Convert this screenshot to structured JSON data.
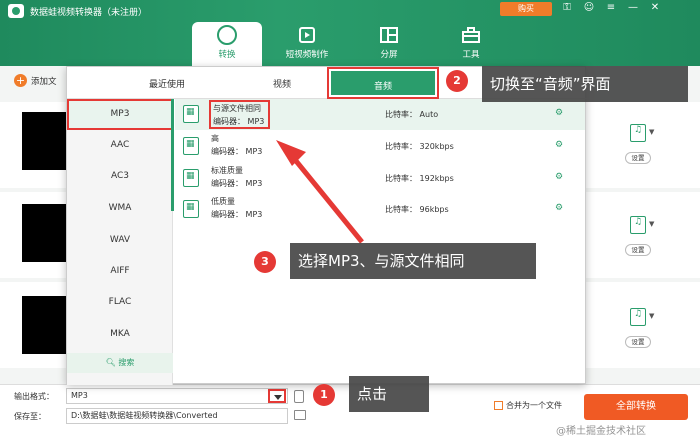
{
  "app": {
    "title": "数据蛙视频转换器（未注册）",
    "buy_label": "购买",
    "win_icons": [
      "key-icon",
      "user-icon",
      "menu-icon",
      "minimize-icon",
      "close-icon"
    ]
  },
  "nav": {
    "tabs": [
      {
        "label": "转换",
        "icon": "refresh-icon",
        "active": true
      },
      {
        "label": "短视频制作",
        "icon": "film-icon"
      },
      {
        "label": "分屏",
        "icon": "split-screen-icon"
      },
      {
        "label": "工具",
        "icon": "toolbox-icon"
      }
    ]
  },
  "main": {
    "add_file_label": "添加文"
  },
  "rows": [
    {
      "setting": "设置",
      "format_badge": "MP3"
    },
    {
      "setting": "设置",
      "format_badge": "MP3"
    },
    {
      "setting": "设置",
      "format_badge": "MP3"
    }
  ],
  "popup": {
    "tabs": [
      {
        "label": "最近使用"
      },
      {
        "label": "视频"
      },
      {
        "label": "音频",
        "active": true
      }
    ],
    "formats": [
      "MP3",
      "AAC",
      "AC3",
      "WMA",
      "WAV",
      "AIFF",
      "FLAC",
      "MKA"
    ],
    "selected_format": "MP3",
    "search_label": "搜索",
    "presets": [
      {
        "name": "与源文件相同",
        "codec": "编码器： MP3",
        "bitrate": "比特率： Auto",
        "selected": true
      },
      {
        "name": "高",
        "codec": "编码器： MP3",
        "bitrate": "比特率： 320kbps"
      },
      {
        "name": "标准质量",
        "codec": "编码器： MP3",
        "bitrate": "比特率： 192kbps"
      },
      {
        "name": "低质量",
        "codec": "编码器： MP3",
        "bitrate": "比特率： 96kbps"
      }
    ]
  },
  "bottom": {
    "output_format_label": "输出格式：",
    "output_format_value": "MP3",
    "save_to_label": "保存至：",
    "save_path": "D:\\数据蛙\\数据蛙视频转换器\\Converted",
    "merge_label": "合并为一个文件",
    "convert_all_label": "全部转换"
  },
  "annotations": [
    {
      "num": "1",
      "text": "点击"
    },
    {
      "num": "2",
      "text": "切换至“音频”界面"
    },
    {
      "num": "3",
      "text": "选择MP3、与源文件相同"
    }
  ],
  "watermark": "@稀土掘金技术社区",
  "colors": {
    "brand": "#2a9d6c",
    "accent": "#f05a24",
    "annotation": "#e53935"
  }
}
